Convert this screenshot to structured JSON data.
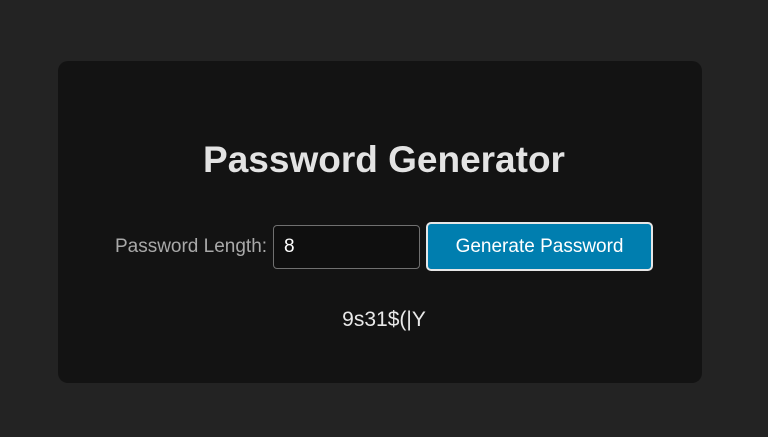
{
  "app": {
    "title": "Password Generator"
  },
  "form": {
    "length_label": "Password Length:",
    "length_value": "8",
    "generate_label": "Generate Password"
  },
  "output": {
    "password": "9s31$(|Y"
  },
  "colors": {
    "page_background": "#232323",
    "card_background": "#131313",
    "button_background": "#007eaf",
    "button_border": "#e6e6e6",
    "title_text": "#e3e3e3",
    "label_text": "#a9a9a9"
  }
}
